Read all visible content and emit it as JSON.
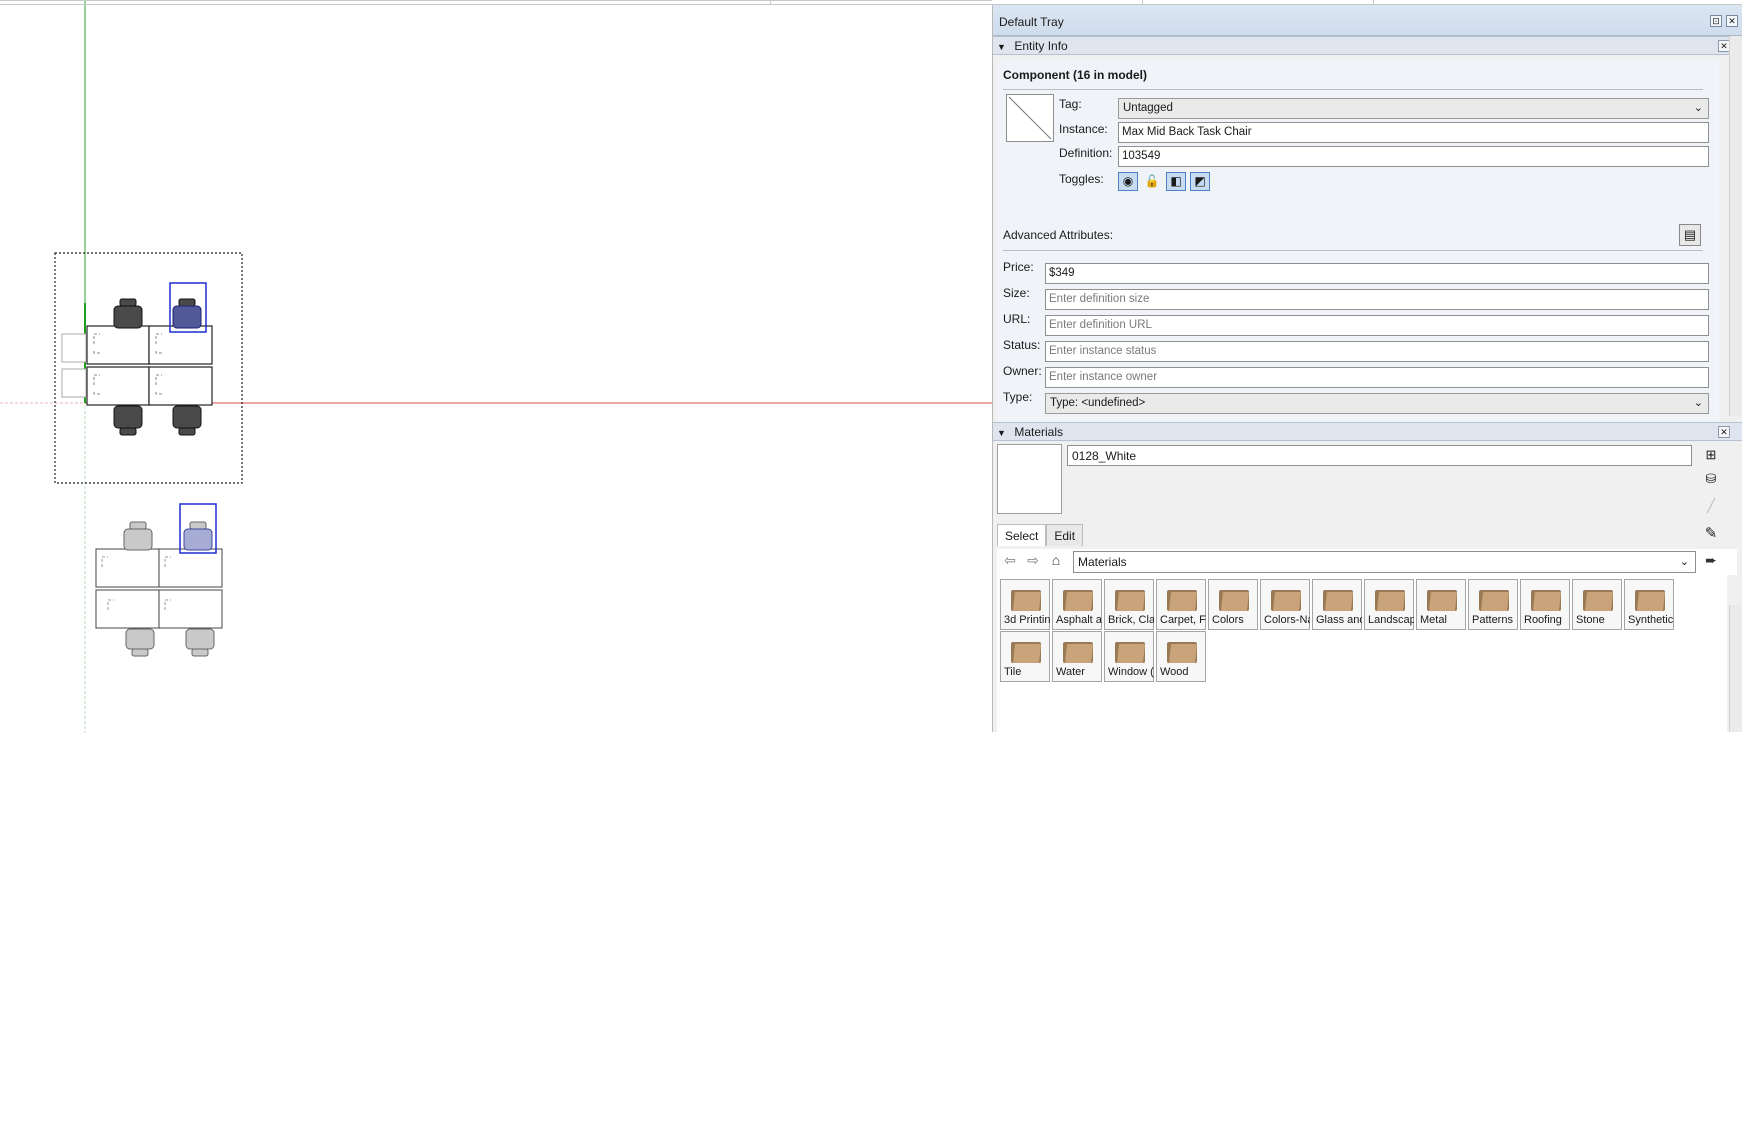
{
  "tray": {
    "title": "Default Tray",
    "pin_icon": "pin-icon",
    "close_icon": "close-icon"
  },
  "entity_info": {
    "panel_title": "Entity Info",
    "heading": "Component (16 in model)",
    "tag": {
      "label": "Tag:",
      "value": "Untagged"
    },
    "instance": {
      "label": "Instance:",
      "value": "Max Mid Back Task Chair"
    },
    "definition": {
      "label": "Definition:",
      "value": "103549"
    },
    "toggles": {
      "label": "Toggles:",
      "icons": [
        "eye-icon",
        "unlock-icon",
        "receive-shadows-icon",
        "cast-shadows-icon"
      ]
    },
    "advanced": {
      "label": "Advanced Attributes:",
      "price": {
        "label": "Price:",
        "value": "$349"
      },
      "size": {
        "label": "Size:",
        "placeholder": "Enter definition size"
      },
      "url": {
        "label": "URL:",
        "placeholder": "Enter definition URL"
      },
      "status": {
        "label": "Status:",
        "placeholder": "Enter instance status"
      },
      "owner": {
        "label": "Owner:",
        "placeholder": "Enter instance owner"
      },
      "type": {
        "label": "Type:",
        "value": "Type: <undefined>"
      }
    }
  },
  "materials": {
    "panel_title": "Materials",
    "current_name": "0128_White",
    "tabs": [
      "Select",
      "Edit"
    ],
    "library": "Materials",
    "items": [
      "3d Printin",
      "Asphalt a",
      "Brick, Cla",
      "Carpet, F",
      "Colors",
      "Colors-Na",
      "Glass and",
      "Landscap",
      "Metal",
      "Patterns",
      "Roofing",
      "Stone",
      "Synthetic",
      "Tile",
      "Water",
      "Window (",
      "Wood"
    ]
  },
  "colors": {
    "selection": "#1e2fcf",
    "red_axis": "#d64b4b",
    "green_axis": "#2ea32e",
    "tray_title_bg": "#d4e0ee",
    "folder": "#c9a47a"
  }
}
